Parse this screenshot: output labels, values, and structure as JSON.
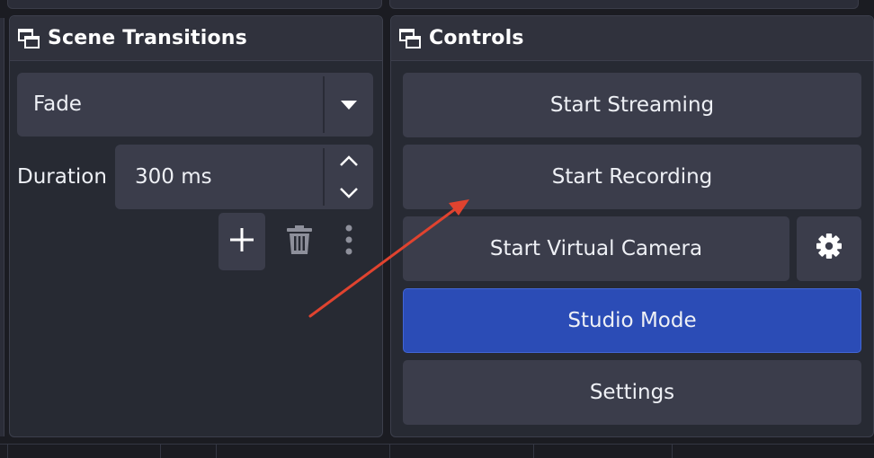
{
  "scene_transitions": {
    "title": "Scene Transitions",
    "transition_value": "Fade",
    "duration_label": "Duration",
    "duration_value": "300 ms"
  },
  "controls": {
    "title": "Controls",
    "start_streaming": "Start Streaming",
    "start_recording": "Start Recording",
    "start_virtual_camera": "Start Virtual Camera",
    "studio_mode": "Studio Mode",
    "settings": "Settings"
  },
  "colors": {
    "background": "#1b1c22",
    "dock_bg": "#272a33",
    "button_bg": "#3b3d4b",
    "studio_mode_active": "#2b4cb6",
    "annotation_arrow": "#e0432f"
  },
  "icons": {
    "dock": "dock-window-icon",
    "dropdown": "chevron-down-icon",
    "spin_up": "chevron-up-icon",
    "spin_down": "chevron-down-icon",
    "add": "plus-icon",
    "remove": "trash-icon",
    "more": "vertical-ellipsis-icon",
    "virtual_camera_settings": "gear-icon"
  }
}
